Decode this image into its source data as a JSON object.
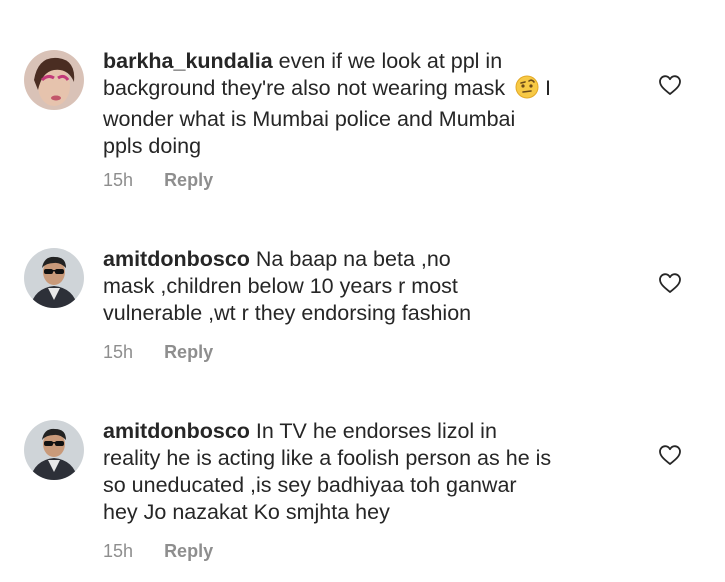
{
  "comments": [
    {
      "username": "barkha_kundalia",
      "lines": [
        "even if we look at ppl in",
        "background they're also not wearing mask",
        "wonder what is Mumbai police and Mumbai",
        "ppls doing"
      ],
      "line2_suffix": " I",
      "emoji": "raised-eyebrow-emoji",
      "time": "15h",
      "reply_label": "Reply"
    },
    {
      "username": "amitdonbosco",
      "lines": [
        "Na baap na beta ,no",
        "mask ,children below 10 years r most",
        "vulnerable ,wt r they endorsing fashion"
      ],
      "time": "15h",
      "reply_label": "Reply"
    },
    {
      "username": "amitdonbosco",
      "lines": [
        "In TV he endorses lizol in",
        "reality he is acting like a foolish person as he is",
        "so uneducated ,is sey badhiyaa toh ganwar",
        "hey Jo nazakat Ko smjhta hey"
      ],
      "time": "15h",
      "reply_label": "Reply"
    }
  ],
  "icons": {
    "like": "heart-outline-icon"
  },
  "colors": {
    "text": "#262626",
    "secondary": "#8e8e8e"
  }
}
